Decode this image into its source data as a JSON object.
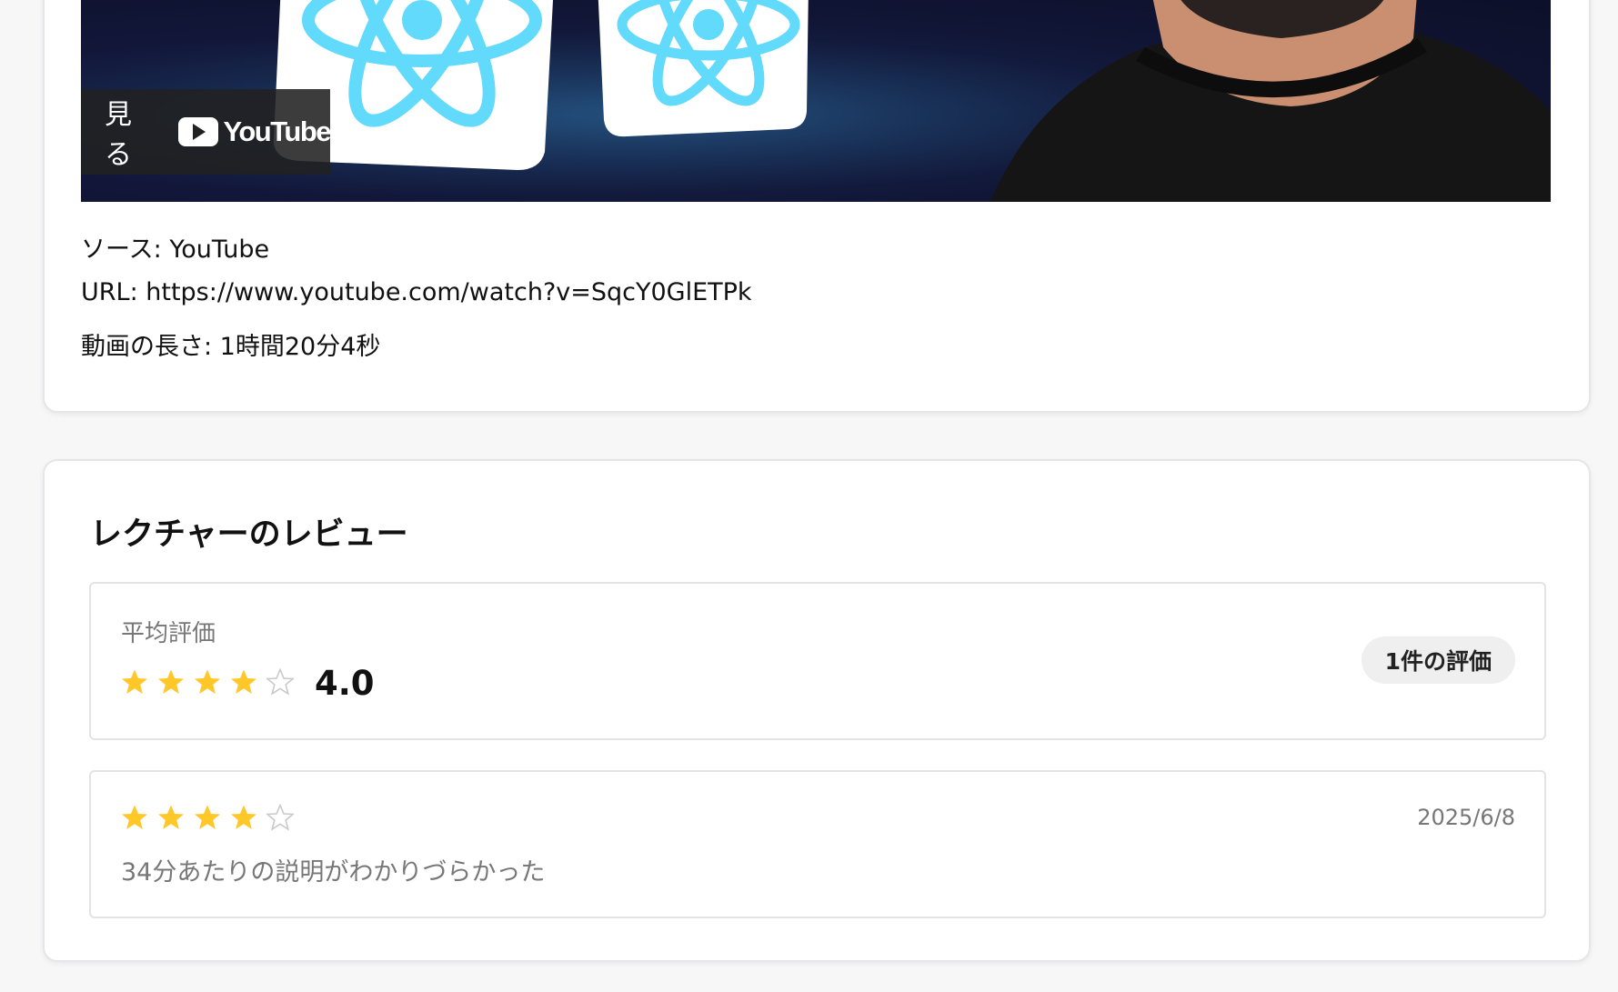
{
  "video": {
    "watch_label": "見る",
    "youtube_logo_text": "YouTube"
  },
  "meta": {
    "source": "ソース: YouTube",
    "url": "URL: https://www.youtube.com/watch?v=SqcY0GlETPk",
    "duration": "動画の長さ: 1時間20分4秒"
  },
  "reviews": {
    "title": "レクチャーのレビュー",
    "average_label": "平均評価",
    "average_value": "4.0",
    "average_stars": 4,
    "max_stars": 5,
    "count_label": "1件の評価",
    "items": [
      {
        "stars": 4,
        "date": "2025/6/8",
        "comment": "34分あたりの説明がわかりづらかった"
      }
    ]
  },
  "colors": {
    "star_filled": "#FFC727",
    "star_empty": "#C9C9C9",
    "react_logo": "#61DAFB"
  }
}
